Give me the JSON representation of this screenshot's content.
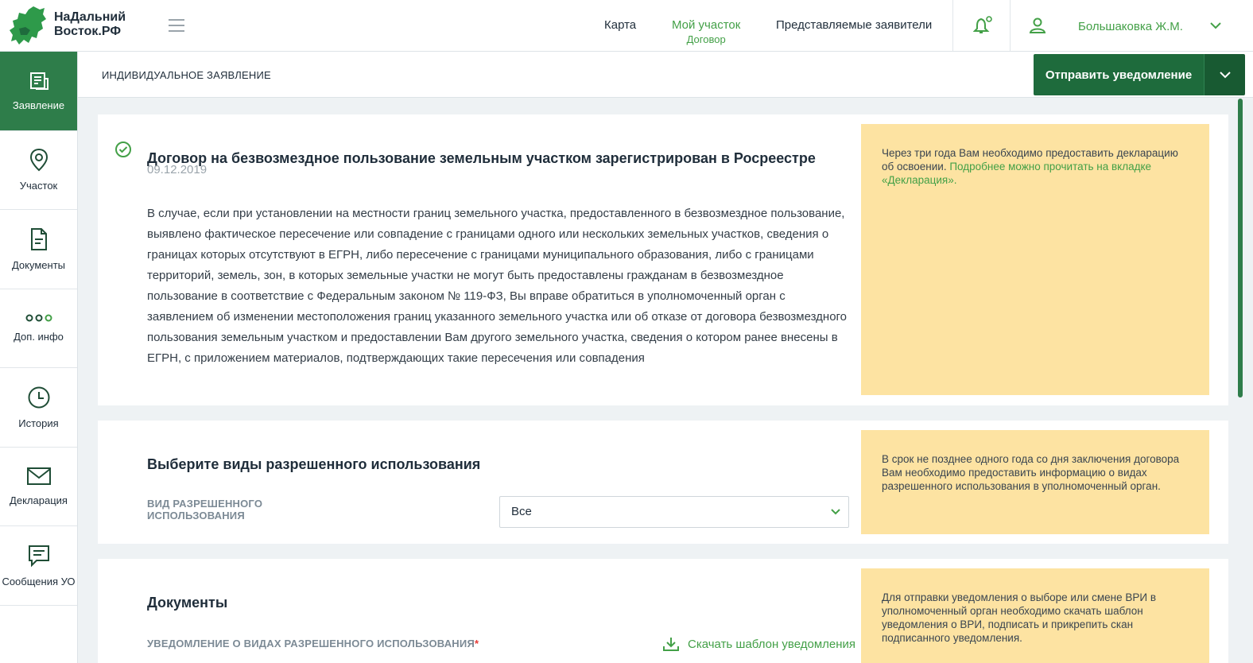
{
  "header": {
    "logo_text_line1": "НаДальний",
    "logo_text_line2": "Восток.РФ",
    "nav": {
      "map": "Карта",
      "my_plot": "Мой участок",
      "my_plot_sub": "Договор",
      "represented": "Представляемые заявители"
    },
    "user_name": "Большаковка Ж.М."
  },
  "sidebar": {
    "items": [
      {
        "label": "Заявление",
        "icon": "document-list-icon"
      },
      {
        "label": "Участок",
        "icon": "map-pin-icon"
      },
      {
        "label": "Документы",
        "icon": "file-icon"
      },
      {
        "label": "Доп. инфо",
        "icon": "dots-icon"
      },
      {
        "label": "История",
        "icon": "clock-icon"
      },
      {
        "label": "Декларация",
        "icon": "envelope-icon"
      },
      {
        "label": "Сообщения УО",
        "icon": "message-icon"
      }
    ]
  },
  "subbar": {
    "title": "ИНДИВИДУАЛЬНОЕ ЗАЯВЛЕНИЕ",
    "send_label": "Отправить уведомление"
  },
  "card1": {
    "title": "Договор на безвозмездное пользование земельным участком зарегистрирован в Росреестре",
    "date": "09.12.2019",
    "text": "В случае, если при установлении на местности границ земельного участка, предоставленного в безвозмездное пользование, выявлено фактическое пересечение или совпадение с границами одного или нескольких земельных участков, сведения о границах которых отсутствуют в ЕГРН, либо пересечение с границами муниципального образования, либо с границами территорий, земель, зон, в которых земельные участки не могут быть предоставлены гражданам в безвозмездное пользование в соответствие с Федеральным законом № 119-ФЗ, Вы вправе обратиться в уполномоченный орган с заявлением об изменении местоположения границ указанного земельного участка или об отказе от договора безвозмездного пользования земельным участком и предоставлении Вам другого земельного участка, сведения о котором ранее внесены в ЕГРН, с приложением материалов, подтверждающих такие пересечения или совпадения",
    "note_text": "Через три года Вам необходимо предоставить декларацию об освоении. ",
    "note_link": "Подробнее можно прочитать на вкладке «Декларация»."
  },
  "card2": {
    "title": "Выберите виды разрешенного использования",
    "field_label_line1": "ВИД РАЗРЕШЕННОГО",
    "field_label_line2": "ИСПОЛЬЗОВАНИЯ",
    "select_value": "Все",
    "note_text": "В срок не позднее одного года со дня заключения договора Вам необходимо предоставить информацию о видах разрешенного использования в уполномоченный орган."
  },
  "card3": {
    "title": "Документы",
    "field_label": "УВЕДОМЛЕНИЕ О ВИДАХ РАЗРЕШЕННОГО ИСПОЛЬЗОВАНИЯ",
    "required_mark": "*",
    "download_label": "Скачать шаблон уведомления",
    "note_text": "Для отправки уведомления о выборе или смене ВРИ в уполномоченный орган необходимо скачать шаблон уведомления о ВРИ, подписать и прикрепить скан подписанного уведомления."
  },
  "colors": {
    "accent": "#43a047",
    "primary_dark": "#1e6b3c",
    "note_bg": "#fde3a2"
  }
}
